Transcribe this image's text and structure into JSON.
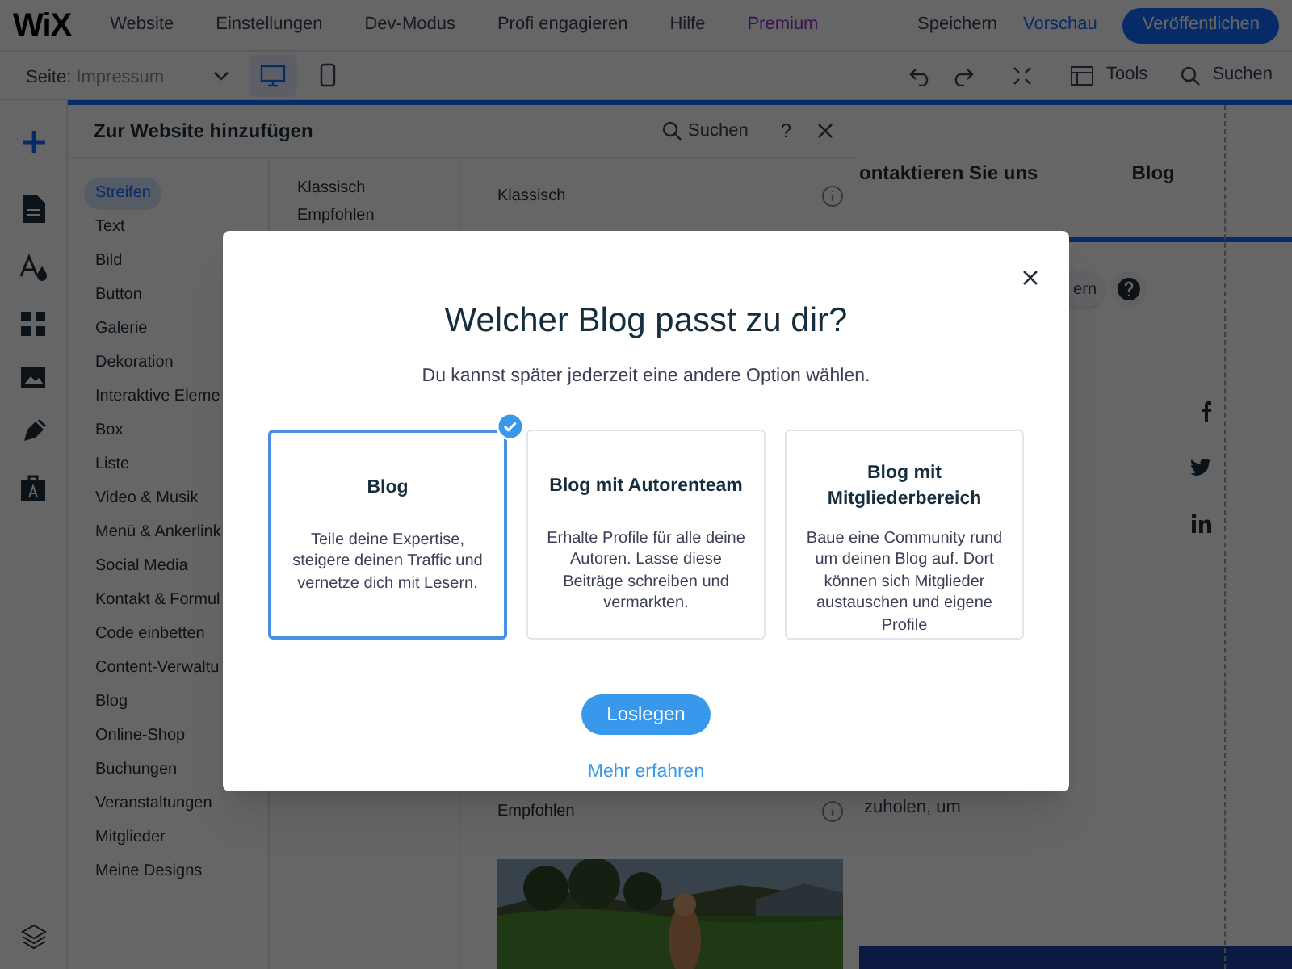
{
  "top_bar": {
    "logo": "WiX",
    "menu": [
      "Website",
      "Einstellungen",
      "Dev-Modus",
      "Profi engagieren",
      "Hilfe"
    ],
    "premium": "Premium",
    "save": "Speichern",
    "preview": "Vorschau",
    "publish": "Veröffentlichen"
  },
  "toolbar": {
    "page_label": "Seite:",
    "page_name": "Impressum",
    "view_modes": [
      {
        "kind": "desktop",
        "selected": true
      },
      {
        "kind": "mobile",
        "selected": false
      }
    ],
    "tools": "Tools",
    "search": "Suchen"
  },
  "add_panel": {
    "title": "Zur Website hinzufügen",
    "search": "Suchen",
    "help": "?",
    "categories": [
      {
        "label": "Streifen",
        "selected": true
      },
      {
        "label": "Text",
        "selected": false
      },
      {
        "label": "Bild",
        "selected": false
      },
      {
        "label": "Button",
        "selected": false
      },
      {
        "label": "Galerie",
        "selected": false
      },
      {
        "label": "Dekoration",
        "selected": false
      },
      {
        "label": "Interaktive Eleme",
        "selected": false
      },
      {
        "label": "Box",
        "selected": false
      },
      {
        "label": "Liste",
        "selected": false
      },
      {
        "label": "Video & Musik",
        "selected": false
      },
      {
        "label": "Menü & Ankerlink",
        "selected": false
      },
      {
        "label": "Social Media",
        "selected": false
      },
      {
        "label": "Kontakt & Formul",
        "selected": false
      },
      {
        "label": "Code einbetten",
        "selected": false
      },
      {
        "label": "Content-Verwaltu",
        "selected": false
      },
      {
        "label": "Blog",
        "selected": false
      },
      {
        "label": "Online-Shop",
        "selected": false
      },
      {
        "label": "Buchungen",
        "selected": false
      },
      {
        "label": "Veranstaltungen",
        "selected": false
      },
      {
        "label": "Mitglieder",
        "selected": false
      },
      {
        "label": "Meine Designs",
        "selected": false
      }
    ],
    "subcategories": [
      "Klassisch",
      "Empfohlen"
    ],
    "sections": [
      "Klassisch",
      "Empfohlen"
    ]
  },
  "canvas": {
    "nav": [
      "ontaktieren Sie uns",
      "Blog"
    ],
    "button_fragment": "ern",
    "text_fragment": "zuholen, um"
  },
  "modal": {
    "title": "Welcher Blog passt zu dir?",
    "subtitle": "Du kannst später jederzeit eine andere Option wählen.",
    "options": [
      {
        "title": "Blog",
        "description": "Teile deine Expertise, steigere deinen Traffic und vernetze dich mit Lesern.",
        "selected": true
      },
      {
        "title": "Blog mit Autorenteam",
        "description": "Erhalte Profile für alle deine Autoren. Lasse diese Beiträge schreiben und vermarkten.",
        "selected": false
      },
      {
        "title": "Blog mit Mitgliederbereich",
        "description": "Baue eine Community rund um deinen Blog auf. Dort können sich Mitglieder austauschen und eigene Profile",
        "selected": false
      }
    ],
    "primary": "Loslegen",
    "link": "Mehr erfahren"
  }
}
